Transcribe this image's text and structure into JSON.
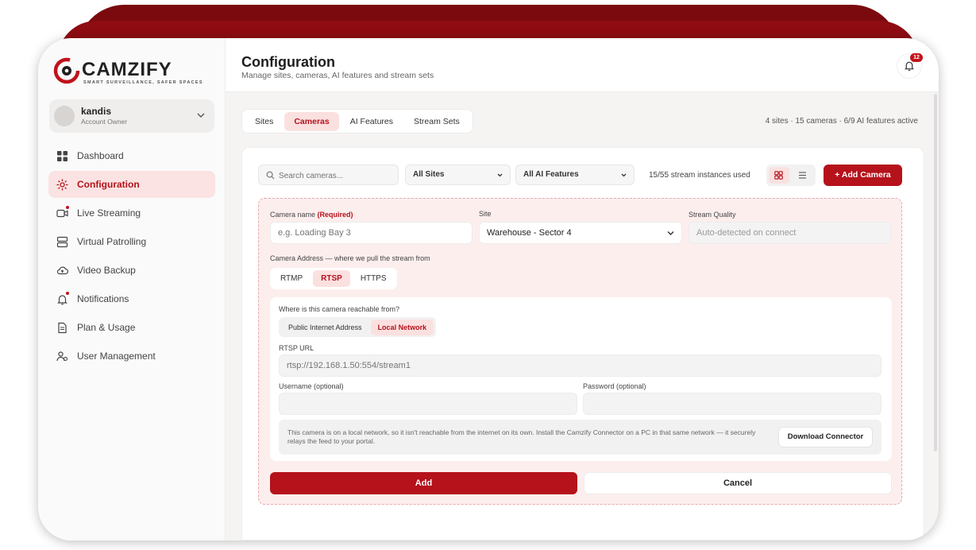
{
  "brand": {
    "name": "CAMZIFY",
    "tagline": "SMART SURVEILLANCE, SAFER SPACES",
    "accent": "#b5121b"
  },
  "account": {
    "name": "kandis",
    "role": "Account Owner"
  },
  "nav": {
    "items": [
      {
        "label": "Dashboard",
        "icon": "grid-icon"
      },
      {
        "label": "Configuration",
        "icon": "gear-icon",
        "active": true
      },
      {
        "label": "Live Streaming",
        "icon": "video-icon"
      },
      {
        "label": "Virtual Patrolling",
        "icon": "server-icon"
      },
      {
        "label": "Video Backup",
        "icon": "cloud-upload-icon"
      },
      {
        "label": "Notifications",
        "icon": "bell-icon"
      },
      {
        "label": "Plan & Usage",
        "icon": "document-icon"
      },
      {
        "label": "User Management",
        "icon": "users-icon"
      }
    ]
  },
  "header": {
    "title": "Configuration",
    "subtitle": "Manage sites, cameras, AI features and stream sets",
    "notification_count": "12"
  },
  "tabs": [
    {
      "label": "Sites"
    },
    {
      "label": "Cameras",
      "active": true
    },
    {
      "label": "AI Features"
    },
    {
      "label": "Stream Sets"
    }
  ],
  "summary": "4 sites · 15 cameras · 6/9 AI features active",
  "toolbar": {
    "search_placeholder": "Search cameras...",
    "site_filter": "All Sites",
    "feature_filter": "All AI Features",
    "usage": "15/55 stream instances used",
    "add_camera": "+ Add Camera"
  },
  "form": {
    "camera_name_label": "Camera name",
    "required_label": "(Required)",
    "camera_name_placeholder": "e.g. Loading Bay 3",
    "site_label": "Site",
    "site_value": "Warehouse - Sector 4",
    "quality_label": "Stream Quality",
    "quality_placeholder": "Auto-detected on connect",
    "address_label": "Camera Address — where we pull the stream from",
    "protocols": [
      {
        "label": "RTMP"
      },
      {
        "label": "RTSP",
        "active": true
      },
      {
        "label": "HTTPS"
      }
    ],
    "reach_label": "Where is this camera reachable from?",
    "reach_options": [
      {
        "label": "Public Internet Address"
      },
      {
        "label": "Local Network",
        "active": true
      }
    ],
    "url_label": "RTSP URL",
    "url_placeholder": "rtsp://192.168.1.50:554/stream1",
    "username_label": "Username (optional)",
    "password_label": "Password (optional)",
    "info_text": "This camera is on a local network, so it isn't reachable from the internet on its own. Install the Camzify Connector on a PC in that same network — it securely relays the feed to your portal.",
    "download_label": "Download Connector",
    "add_label": "Add",
    "cancel_label": "Cancel"
  }
}
